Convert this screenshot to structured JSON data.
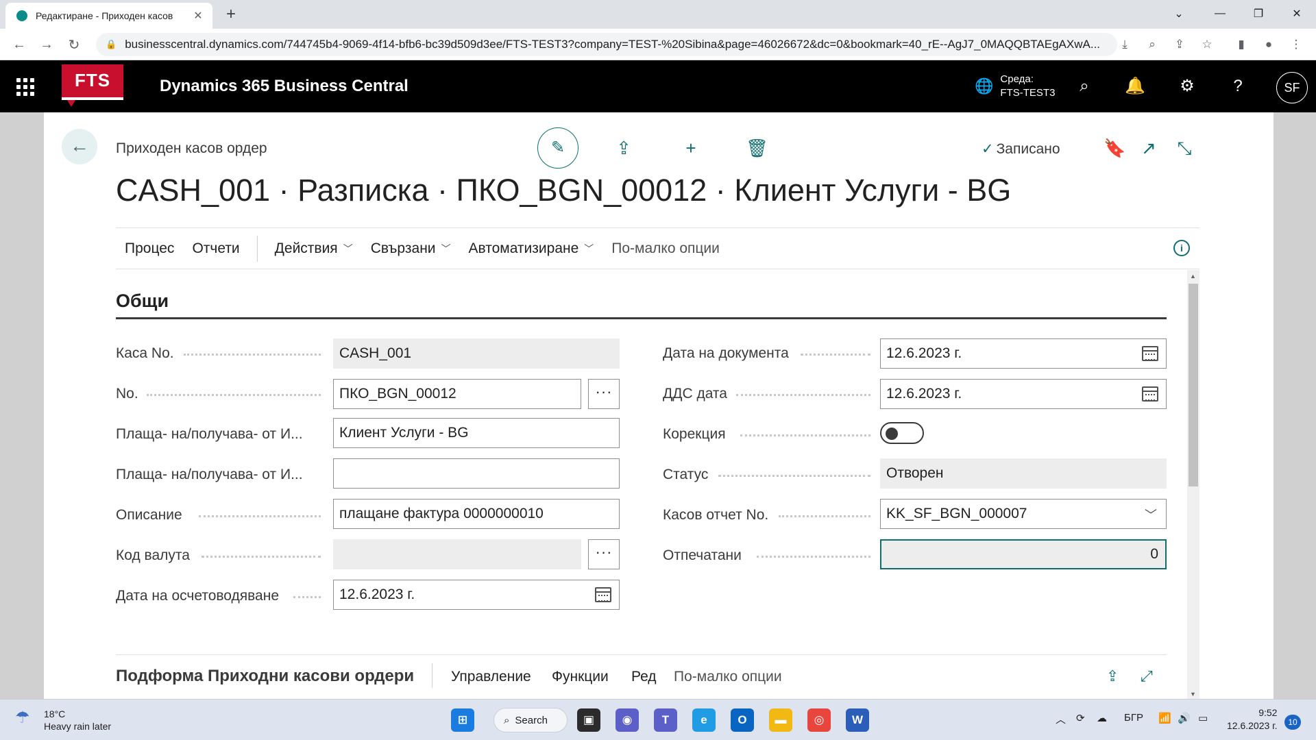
{
  "browser": {
    "tab_title": "Редактиране - Приходен касов",
    "tab_close": "✕",
    "new_tab": "+",
    "url": "businesscentral.dynamics.com/744745b4-9069-4f14-bfb6-bc39d509d3ee/FTS-TEST3?company=TEST-%20Sibina&page=46026672&dc=0&bookmark=40_rE--AgJ7_0MAQQBTAEgAXwA..."
  },
  "app": {
    "logo_text": "FTS",
    "title": "Dynamics 365 Business Central",
    "env_line1": "Среда:",
    "env_line2": "FTS-TEST3",
    "avatar": "SF"
  },
  "page": {
    "breadcrumb": "Приходен касов ордер",
    "saved_status": "Записано",
    "title": "CASH_001 · Разписка · ПКО_BGN_00012 · Клиент Услуги - BG"
  },
  "actionbar": {
    "process": "Процес",
    "reports": "Отчети",
    "actions": "Действия",
    "related": "Свързани",
    "automate": "Автоматизиране",
    "fewer": "По-малко опции"
  },
  "general": {
    "section_title": "Общи",
    "left": [
      {
        "label": "Каса No.",
        "value": "CASH_001"
      },
      {
        "label": "No.",
        "value": "ПКО_BGN_00012"
      },
      {
        "label": "Плаща- на/получава- от И...",
        "value": "Клиент Услуги - BG"
      },
      {
        "label": "Плаща- на/получава- от И...",
        "value": ""
      },
      {
        "label": "Описание",
        "value": "плащане фактура 0000000010"
      },
      {
        "label": "Код валута",
        "value": ""
      },
      {
        "label": "Дата на осчетоводяване",
        "value": "12.6.2023 г."
      }
    ],
    "right": [
      {
        "label": "Дата на документа",
        "value": "12.6.2023 г."
      },
      {
        "label": "ДДС дата",
        "value": "12.6.2023 г."
      },
      {
        "label": "Корекция",
        "value": ""
      },
      {
        "label": "Статус",
        "value": "Отворен"
      },
      {
        "label": "Касов отчет No.",
        "value": "KK_SF_BGN_000007"
      },
      {
        "label": "Отпечатани",
        "value": "0"
      }
    ],
    "ellipsis": "···"
  },
  "subform": {
    "title": "Подформа Приходни касови ордери",
    "manage": "Управление",
    "functions": "Функции",
    "line": "Ред",
    "fewer": "По-малко опции"
  },
  "taskbar": {
    "temp": "18°C",
    "forecast": "Heavy rain later",
    "search": "Search",
    "lang": "БГР",
    "time": "9:52",
    "date": "12.6.2023 г.",
    "notif_count": "10"
  }
}
